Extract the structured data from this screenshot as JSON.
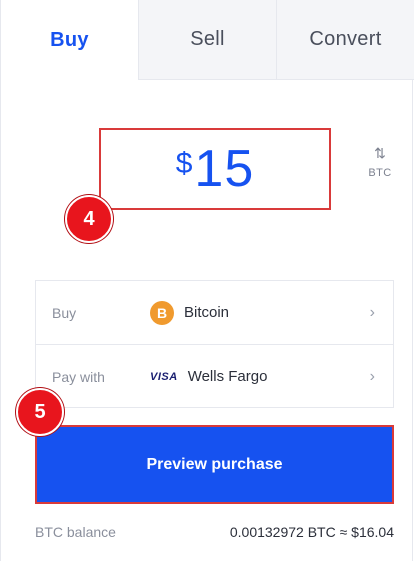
{
  "tabs": [
    {
      "label": "Buy",
      "active": true
    },
    {
      "label": "Sell",
      "active": false
    },
    {
      "label": "Convert",
      "active": false
    }
  ],
  "amount": {
    "currency_symbol": "$",
    "value": "15"
  },
  "switch": {
    "arrows": "⇅",
    "unit": "BTC"
  },
  "badges": {
    "step4": "4",
    "step5": "5"
  },
  "rows": {
    "buy": {
      "label": "Buy",
      "icon_glyph": "B",
      "value": "Bitcoin",
      "chevron": "›"
    },
    "pay": {
      "label": "Pay with",
      "icon_text": "VISA",
      "value": "Wells Fargo",
      "chevron": "›"
    }
  },
  "preview_button": {
    "label": "Preview purchase"
  },
  "balance": {
    "label": "BTC balance",
    "value": "0.00132972 BTC  ≈ $16.04"
  },
  "colors": {
    "accent": "#1652f0",
    "highlight": "#d93a3a",
    "badge": "#e8151d",
    "bitcoin": "#f09a2e"
  },
  "icons": [
    "swap-arrows-icon",
    "bitcoin-icon",
    "visa-icon",
    "chevron-right-icon"
  ]
}
